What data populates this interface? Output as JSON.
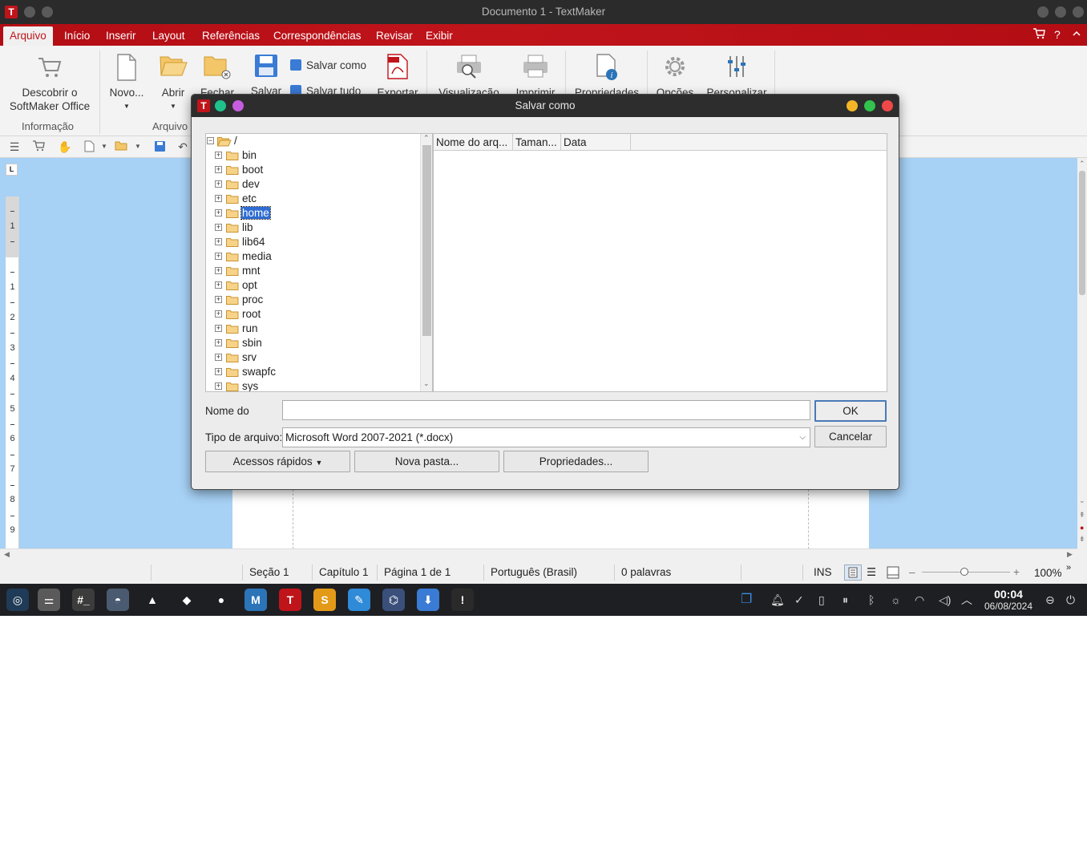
{
  "window": {
    "title": "Documento 1 - TextMaker",
    "app_icon": "T"
  },
  "menu": {
    "items": [
      "Arquivo",
      "Início",
      "Inserir",
      "Layout",
      "Referências",
      "Correspondências",
      "Revisar",
      "Exibir"
    ],
    "active": "Arquivo",
    "help_label": "?"
  },
  "ribbon": {
    "descobrir_l1": "Descobrir o",
    "descobrir_l2": "SoftMaker Office",
    "novo": "Novo...",
    "abrir": "Abrir",
    "fechar": "Fechar",
    "salvar": "Salvar",
    "salvar_como": "Salvar como",
    "salvar_tudo": "Salvar tudo",
    "exportar": "Exportar",
    "visualizacao": "Visualização",
    "imprimir": "Imprimir",
    "propriedades": "Propriedades",
    "opcoes": "Opções",
    "personalizar": "Personalizar",
    "group_informacao": "Informação",
    "group_arquivo": "Arquivo"
  },
  "ruler": {
    "corner": "L",
    "numbers": [
      "1",
      "1",
      "2",
      "3",
      "4",
      "5",
      "6",
      "7",
      "8",
      "9"
    ]
  },
  "status": {
    "secao": "Seção 1",
    "capitulo": "Capítulo 1",
    "pagina": "Página 1 de 1",
    "idioma": "Português (Brasil)",
    "palavras": "0 palavras",
    "modo": "INS",
    "zoom_minus": "–",
    "zoom_plus": "+",
    "zoom": "100%"
  },
  "taskbar": {
    "apps": [
      {
        "name": "zorin-icon",
        "color": "#1f3b57",
        "glyph": "◎"
      },
      {
        "name": "settings-icon",
        "color": "#5a5a5a",
        "glyph": "⚌"
      },
      {
        "name": "terminal-icon",
        "color": "#3c3c3c",
        "glyph": "#_"
      },
      {
        "name": "files-icon",
        "color": "#4a5a70",
        "glyph": "◓"
      },
      {
        "name": "vlc-icon",
        "color": "#1e1f22",
        "glyph": "▲"
      },
      {
        "name": "brave-icon",
        "color": "#1e1f22",
        "glyph": "◆"
      },
      {
        "name": "chrome-icon",
        "color": "#1e1f22",
        "glyph": "●"
      },
      {
        "name": "planmaker-icon",
        "color": "#2b74b8",
        "glyph": "M"
      },
      {
        "name": "textmaker-icon",
        "color": "#c0141b",
        "glyph": "T"
      },
      {
        "name": "presentations-icon",
        "color": "#e39a18",
        "glyph": "S"
      },
      {
        "name": "editor-icon",
        "color": "#2f8ad8",
        "glyph": "✎"
      },
      {
        "name": "zorin-connect-icon",
        "color": "#3a4f7a",
        "glyph": "⌬"
      },
      {
        "name": "download-icon",
        "color": "#3a7bd5",
        "glyph": "⬇"
      },
      {
        "name": "unknown-app-icon",
        "color": "#2a2a2a",
        "glyph": "!"
      }
    ],
    "time": "00:04",
    "date": "06/08/2024"
  },
  "dialog": {
    "title": "Salvar como",
    "root": "/",
    "folders": [
      "bin",
      "boot",
      "dev",
      "etc",
      "home",
      "lib",
      "lib64",
      "media",
      "mnt",
      "opt",
      "proc",
      "root",
      "run",
      "sbin",
      "srv",
      "swapfc",
      "sys"
    ],
    "selected_folder": "home",
    "columns": [
      "Nome do arq...",
      "Taman...",
      "Data"
    ],
    "filename_label": "Nome do",
    "filename_value": "",
    "filetype_label": "Tipo de arquivo:",
    "filetype_value": "Microsoft Word 2007-2021 (*.docx)",
    "ok": "OK",
    "cancel": "Cancelar",
    "quick_access": "Acessos rápidos",
    "new_folder": "Nova pasta...",
    "properties": "Propriedades..."
  },
  "colors": {
    "accent_red": "#c0141b",
    "doc_background": "#a7d1f5",
    "selection": "#2f6dd3"
  }
}
